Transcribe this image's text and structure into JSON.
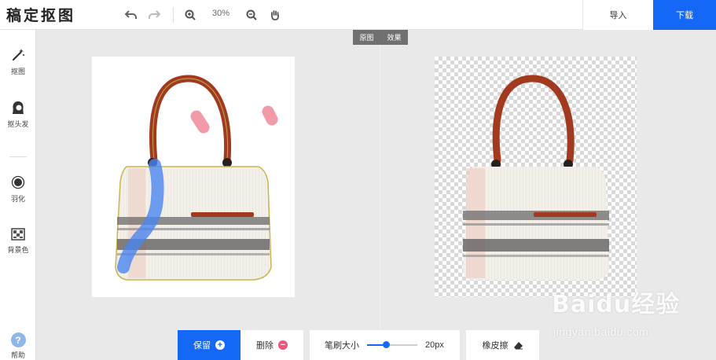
{
  "app": {
    "title": "稿定抠图"
  },
  "toolbar": {
    "zoom": "30%",
    "import_label": "导入",
    "download_label": "下载",
    "icons": [
      "undo-icon",
      "redo-icon",
      "zoom-in-icon",
      "zoom-out-icon",
      "hand-icon"
    ]
  },
  "sidebar": {
    "items": [
      {
        "label": "抠图",
        "icon": "magic-wand-icon"
      },
      {
        "label": "抠头发",
        "icon": "hair-head-icon"
      },
      {
        "label": "羽化",
        "icon": "feather-circle-icon"
      },
      {
        "label": "背景色",
        "icon": "background-grid-icon"
      }
    ],
    "help_label": "帮助"
  },
  "view_tabs": [
    "原图",
    "效果"
  ],
  "bottom": {
    "save_label": "保留",
    "delete_label": "删除",
    "brush_label": "笔刷大小",
    "brush_value": "20px",
    "brush_fraction": 0.38,
    "eraser_label": "橡皮擦"
  },
  "watermark": {
    "text": "Baidu经验",
    "url": "jingyan.baidu.com"
  },
  "colors": {
    "accent": "#1468f5",
    "keep_stroke": "#4a86f0",
    "remove_stroke": "#f08a9a",
    "handle": "#a23a1f"
  }
}
